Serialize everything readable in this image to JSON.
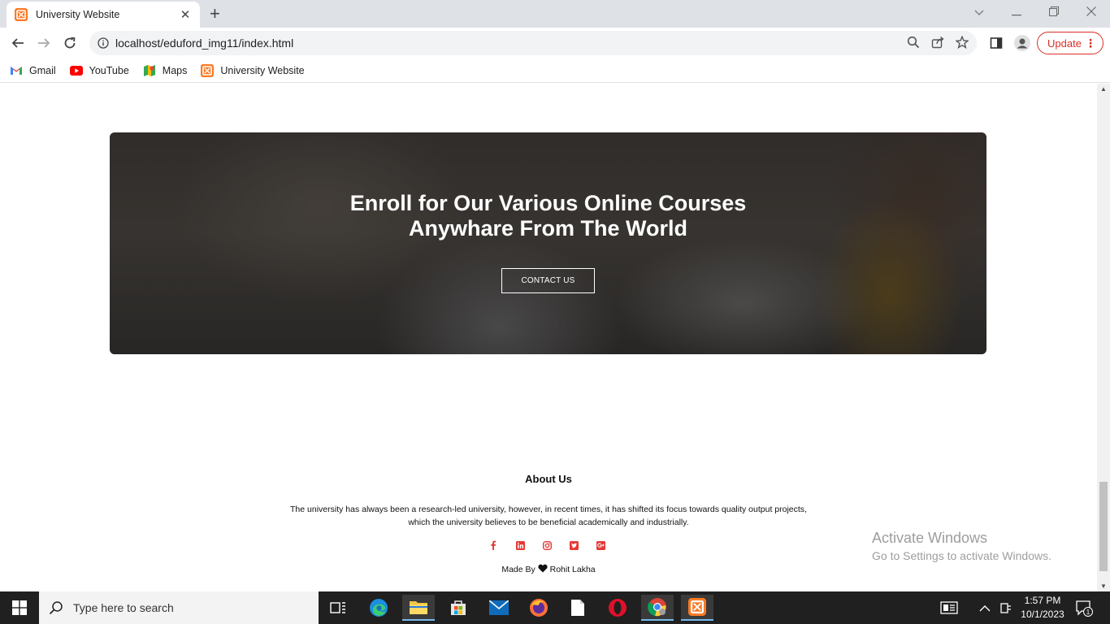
{
  "browser": {
    "tab_title": "University Website",
    "url": "localhost/eduford_img11/index.html",
    "update_label": "Update",
    "bookmarks": [
      {
        "label": "Gmail",
        "icon": "gmail-icon"
      },
      {
        "label": "YouTube",
        "icon": "youtube-icon"
      },
      {
        "label": "Maps",
        "icon": "maps-icon"
      },
      {
        "label": "University Website",
        "icon": "xampp-icon"
      }
    ]
  },
  "page": {
    "banner": {
      "heading_line1": "Enroll for Our Various Online Courses",
      "heading_line2": "Anywhare From The World",
      "cta_label": "CONTACT US"
    },
    "footer": {
      "title": "About Us",
      "text_line1": "The university has always been a research-led university, however, in recent times, it has shifted its focus towards quality output projects,",
      "text_line2": "which the university believes to be beneficial academically and industrially.",
      "socials": [
        "facebook-icon",
        "linkedin-icon",
        "instagram-icon",
        "twitter-icon",
        "google-plus-icon"
      ],
      "made_by_prefix": "Made By",
      "made_by_name": "Rohit Lakha"
    }
  },
  "watermark": {
    "line1": "Activate Windows",
    "line2": "Go to Settings to activate Windows."
  },
  "taskbar": {
    "search_placeholder": "Type here to search",
    "time": "1:57 PM",
    "date": "10/1/2023",
    "notification_count": "1"
  },
  "colors": {
    "social_red": "#e53935",
    "update_red": "#d93025"
  }
}
